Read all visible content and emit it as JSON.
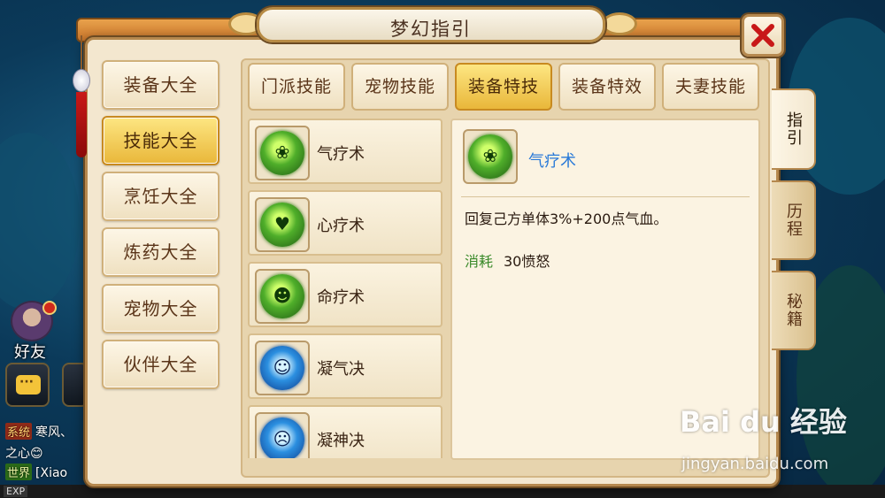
{
  "window": {
    "title": "梦幻指引",
    "title_ink": "梦幻指引"
  },
  "categories": [
    {
      "label": "装备大全",
      "active": false
    },
    {
      "label": "技能大全",
      "active": true
    },
    {
      "label": "烹饪大全",
      "active": false
    },
    {
      "label": "炼药大全",
      "active": false
    },
    {
      "label": "宠物大全",
      "active": false
    },
    {
      "label": "伙伴大全",
      "active": false
    }
  ],
  "tabs": [
    {
      "label": "门派技能",
      "active": false
    },
    {
      "label": "宠物技能",
      "active": false
    },
    {
      "label": "装备特技",
      "active": true
    },
    {
      "label": "装备特效",
      "active": false
    },
    {
      "label": "夫妻技能",
      "active": false
    }
  ],
  "skills": [
    {
      "name": "气疗术",
      "icon": "heal-leaf-icon",
      "color": "green"
    },
    {
      "name": "心疗术",
      "icon": "heart-heal-icon",
      "color": "green"
    },
    {
      "name": "命疗术",
      "icon": "life-heal-icon",
      "color": "green"
    },
    {
      "name": "凝气决",
      "icon": "spirit-blue-icon",
      "color": "blue"
    },
    {
      "name": "凝神决",
      "icon": "mind-blue-icon",
      "color": "blue"
    }
  ],
  "detail": {
    "name": "气疗术",
    "description": "回复己方单体3%+200点气血。",
    "cost_label": "消耗",
    "cost_value": "30愤怒"
  },
  "side_tabs": [
    {
      "label": "指引",
      "active": true
    },
    {
      "label": "历程",
      "active": false
    },
    {
      "label": "秘籍",
      "active": false
    }
  ],
  "hud": {
    "friend_label": "好友",
    "chat_lines": [
      {
        "tag": "系统",
        "text": "寒风、"
      },
      {
        "tag": "",
        "text": "之心😊"
      },
      {
        "tag": "世界",
        "text": "[Xiao"
      }
    ],
    "exp_label": "EXP"
  },
  "watermark": {
    "logo": "Bai  du 经验",
    "url": "jingyan.baidu.com"
  },
  "colors": {
    "accent_gold": "#e9b73a",
    "panel": "#f3e7cf",
    "link_blue": "#2a7ad8",
    "cost_green": "#3a8a2a"
  }
}
